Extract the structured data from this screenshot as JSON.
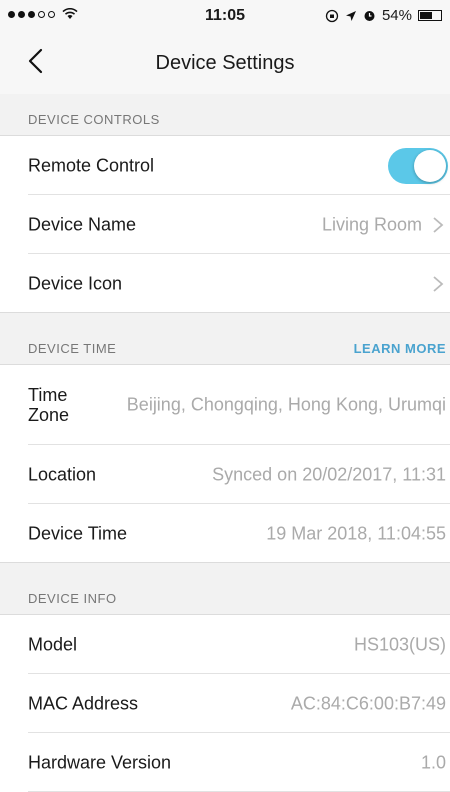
{
  "status_bar": {
    "time": "11:05",
    "battery": "54%",
    "battery_level": 0.54,
    "signal_dots_filled": 3,
    "signal_dots_total": 5
  },
  "nav": {
    "title": "Device Settings"
  },
  "sections": {
    "controls": {
      "header": "DEVICE CONTROLS",
      "remote_control": {
        "label": "Remote Control",
        "enabled": true
      },
      "device_name": {
        "label": "Device Name",
        "value": "Living Room"
      },
      "device_icon": {
        "label": "Device Icon"
      }
    },
    "time": {
      "header": "DEVICE TIME",
      "action": "LEARN MORE",
      "time_zone": {
        "label": "Time Zone",
        "value": "Beijing, Chongqing, Hong Kong, Urumqi"
      },
      "location": {
        "label": "Location",
        "value": "Synced on 20/02/2017, 11:31"
      },
      "device_time": {
        "label": "Device Time",
        "value": "19 Mar 2018, 11:04:55"
      }
    },
    "info": {
      "header": "DEVICE INFO",
      "model": {
        "label": "Model",
        "value": "HS103(US)"
      },
      "mac": {
        "label": "MAC Address",
        "value": "AC:84:C6:00:B7:49"
      },
      "hardware": {
        "label": "Hardware Version",
        "value": "1.0"
      }
    }
  },
  "colors": {
    "accent": "#4aa3cf",
    "toggle_on": "#5bc8e8"
  }
}
